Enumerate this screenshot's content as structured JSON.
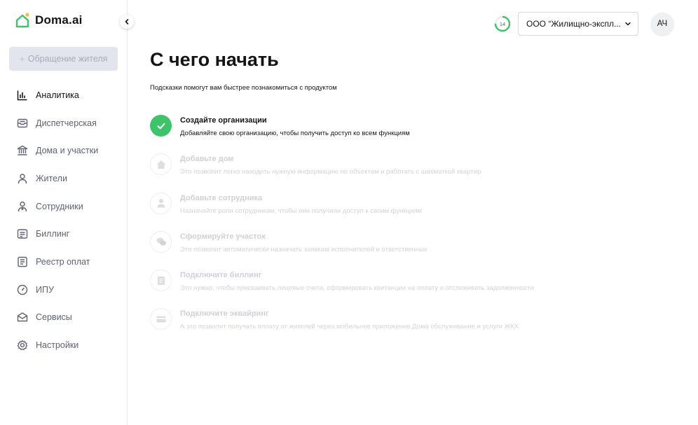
{
  "app": {
    "name": "Doma.ai"
  },
  "sidebar": {
    "new_request_label": "Обращение жителя",
    "items": [
      {
        "label": "Аналитика",
        "icon": "chart-bars-icon",
        "active": true
      },
      {
        "label": "Диспетчерская",
        "icon": "inbox-icon",
        "active": false
      },
      {
        "label": "Дома и участки",
        "icon": "bank-building-icon",
        "active": false
      },
      {
        "label": "Жители",
        "icon": "person-icon",
        "active": false
      },
      {
        "label": "Сотрудники",
        "icon": "employee-icon",
        "active": false
      },
      {
        "label": "Биллинг",
        "icon": "billing-icon",
        "active": false
      },
      {
        "label": "Реестр оплат",
        "icon": "payments-registry-icon",
        "active": false
      },
      {
        "label": "ИПУ",
        "icon": "meter-gauge-icon",
        "active": false
      },
      {
        "label": "Сервисы",
        "icon": "services-box-icon",
        "active": false
      },
      {
        "label": "Настройки",
        "icon": "gear-icon",
        "active": false
      }
    ]
  },
  "header": {
    "progress_value": "14",
    "org_name": "ООО “Жилищно-экспл...",
    "avatar_initials": "АЧ"
  },
  "main": {
    "title": "С чего начать",
    "subtitle": "Подсказки помогут вам быстрее познакомиться с продуктом",
    "steps": [
      {
        "title": "Создайте организации",
        "description": "Добавляйте свою организацию, чтобы получить доступ ко всем функциям",
        "status": "done",
        "icon": "check-icon"
      },
      {
        "title": "Добавьте дом",
        "description": "Это позволит легко находить нужную информацию по объектам и работать с шахматкой квартир",
        "status": "pending",
        "icon": "house-icon"
      },
      {
        "title": "Добавьте сотрудника",
        "description": "Назначайте роли сотрудникам, чтобы они получили доступ к своим функциям",
        "status": "pending",
        "icon": "person-icon"
      },
      {
        "title": "Сформируйте участок",
        "description": "Это позволит автоматически назначать заявкам исполнителей и ответственных",
        "status": "pending",
        "icon": "chat-bubbles-icon"
      },
      {
        "title": "Подключите биллинг",
        "description": "Это нужно, чтобы присваивать лицевые счета, сформировать квитанции на оплату и отслеживать задолженности",
        "status": "pending",
        "icon": "document-icon"
      },
      {
        "title": "Подключите эквайринг",
        "description": "А это позволит получать оплату от жителей через мобильное приложение Домá обслуживание и услуги ЖКХ",
        "status": "pending",
        "icon": "card-icon"
      }
    ]
  },
  "colors": {
    "accent_green": "#3ec36b",
    "text_primary": "#141414",
    "text_secondary": "#5e6371",
    "muted": "#cfd1d8",
    "logo_accent": "#f6b73c",
    "logo_green": "#3ec36b"
  }
}
